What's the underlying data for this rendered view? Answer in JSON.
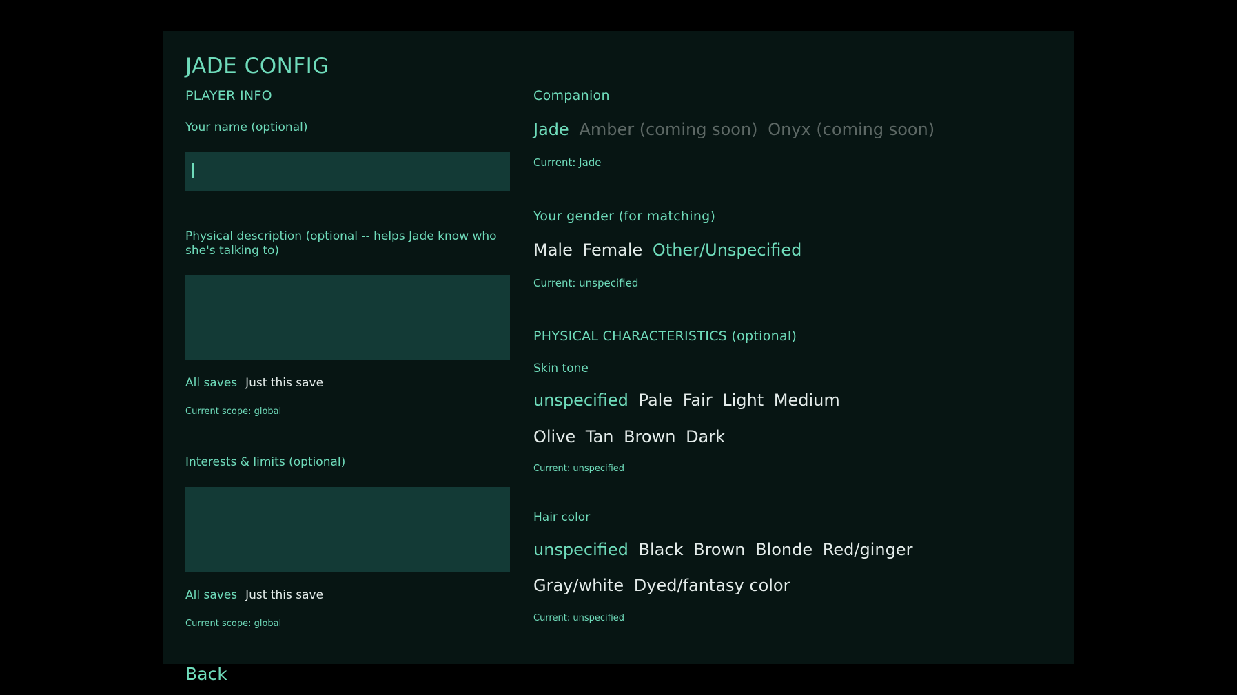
{
  "title": "JADE CONFIG",
  "player_info": {
    "heading": "PLAYER INFO",
    "name_label": "Your name (optional)",
    "name_value": "",
    "physical_label": "Physical description (optional -- helps Jade know who she's talking to)",
    "physical_value": "",
    "physical_scope": {
      "all_saves": "All saves",
      "just_this_save": "Just this save",
      "current": "Current scope: global"
    },
    "interests_label": "Interests & limits (optional)",
    "interests_value": "",
    "interests_scope": {
      "all_saves": "All saves",
      "just_this_save": "Just this save",
      "current": "Current scope: global"
    }
  },
  "companion": {
    "heading": "Companion",
    "options": [
      "Jade",
      "Amber (coming soon)",
      "Onyx (coming soon)"
    ],
    "selected": "Jade",
    "current": "Current: Jade"
  },
  "gender": {
    "heading": "Your gender (for matching)",
    "options": [
      "Male",
      "Female",
      "Other/Unspecified"
    ],
    "selected": "Other/Unspecified",
    "current": "Current: unspecified"
  },
  "physical_characteristics": {
    "heading": "PHYSICAL CHARACTERISTICS (optional)",
    "skin_tone": {
      "label": "Skin tone",
      "row1": [
        "unspecified",
        "Pale",
        "Fair",
        "Light",
        "Medium"
      ],
      "row2": [
        "Olive",
        "Tan",
        "Brown",
        "Dark"
      ],
      "selected": "unspecified",
      "current": "Current: unspecified"
    },
    "hair_color": {
      "label": "Hair color",
      "row1": [
        "unspecified",
        "Black",
        "Brown",
        "Blonde",
        "Red/ginger"
      ],
      "row2": [
        "Gray/white",
        "Dyed/fantasy color"
      ],
      "selected": "unspecified",
      "current": "Current: unspecified"
    }
  },
  "back_label": "Back",
  "colors": {
    "accent": "#6fdcbb",
    "panel": "#071513",
    "input": "#133a36",
    "text": "#e4ecea",
    "disabled": "#5d6865"
  }
}
